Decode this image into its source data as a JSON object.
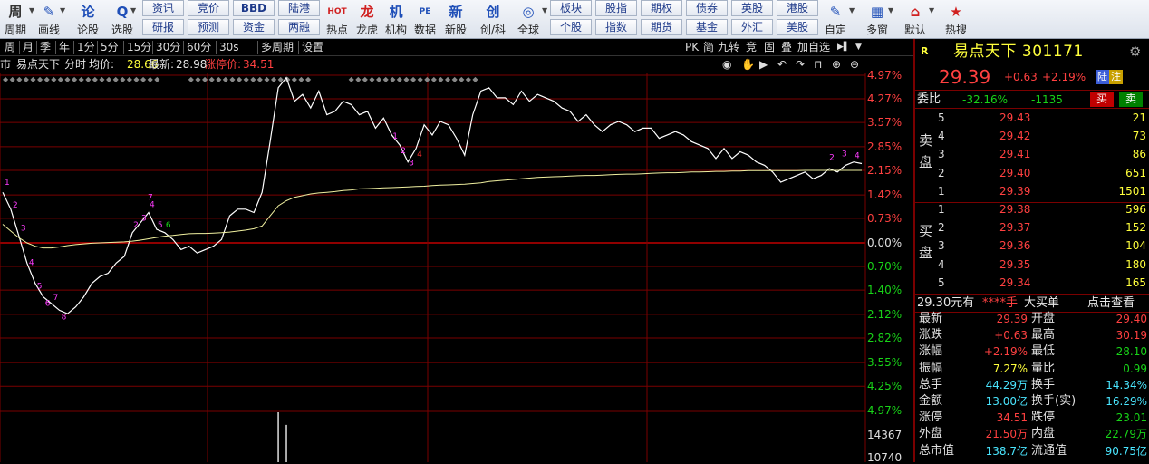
{
  "toolbar": {
    "big": [
      {
        "label": "周期",
        "icon": "周"
      },
      {
        "label": "画线",
        "icon": "✎"
      },
      {
        "label": "论股",
        "icon": "论"
      },
      {
        "label": "选股",
        "icon": "Q"
      },
      {
        "label": "热点",
        "icon": "HOT"
      },
      {
        "label": "龙虎",
        "icon": "龙"
      },
      {
        "label": "机构",
        "icon": "机"
      },
      {
        "label": "数据",
        "icon": "PE"
      },
      {
        "label": "新股",
        "icon": "新"
      },
      {
        "label": "创/科",
        "icon": "创"
      },
      {
        "label": "全球",
        "icon": "◎"
      },
      {
        "label": "自定",
        "icon": "✎"
      },
      {
        "label": "多窗",
        "icon": "▦"
      },
      {
        "label": "默认",
        "icon": "⌂"
      },
      {
        "label": "热搜",
        "icon": "★"
      }
    ],
    "small_top": [
      "资讯",
      "竞价",
      "BBD",
      "陆港",
      "板块",
      "股指",
      "期权",
      "债券",
      "英股",
      "港股"
    ],
    "small_bottom": [
      "研报",
      "预测",
      "资金",
      "两融",
      "个股",
      "指数",
      "期货",
      "基金",
      "外汇",
      "美股"
    ]
  },
  "period_bar": {
    "left_label": "",
    "items": [
      "周",
      "月",
      "季",
      "年",
      "1分",
      "5分",
      "15分",
      "30分",
      "60分",
      "30s",
      "多周期",
      "设置"
    ],
    "right_items": [
      "PK",
      "简",
      "九转",
      "竞",
      "固",
      "叠",
      "加自选"
    ]
  },
  "info_bar": {
    "market": "市",
    "stock_name": "易点天下",
    "mode": "分时",
    "avg_label": "均价:",
    "avg_value": "28.66",
    "latest_label": "最新:",
    "latest_value": "28.98",
    "limit_label": "涨停价:",
    "limit_value": "34.51"
  },
  "axis": {
    "right_labels": [
      "4.97%",
      "4.27%",
      "3.57%",
      "2.85%",
      "2.15%",
      "1.42%",
      "0.73%",
      "0.00%",
      "0.70%",
      "1.40%",
      "2.12%",
      "2.82%",
      "3.55%",
      "4.25%",
      "4.97%",
      "14367",
      "10740"
    ]
  },
  "chart_data": {
    "type": "line",
    "title": "",
    "xlabel": "",
    "ylabel": "",
    "ylim_pct": [
      -4.97,
      4.97
    ],
    "series": [
      {
        "name": "",
        "kind": "price_pct",
        "values": [
          1.5,
          1.0,
          0.2,
          -0.6,
          -1.2,
          -1.6,
          -1.8,
          -2.0,
          -2.1,
          -1.9,
          -1.6,
          -1.2,
          -1.0,
          -0.9,
          -0.6,
          -0.4,
          0.3,
          0.6,
          0.9,
          0.4,
          0.3,
          0.1,
          -0.2,
          -0.1,
          -0.3,
          -0.2,
          -0.1,
          0.1,
          0.8,
          1.0,
          1.0,
          0.9,
          1.5,
          3.0,
          4.6,
          4.9,
          4.2,
          4.4,
          4.0,
          4.5,
          3.8,
          3.9,
          4.2,
          4.1,
          3.8,
          3.9,
          3.4,
          3.7,
          3.2,
          2.9,
          2.4,
          2.8,
          3.5,
          3.2,
          3.6,
          3.5,
          3.1,
          2.6,
          3.8,
          4.5,
          4.6,
          4.3,
          4.3,
          4.1,
          4.5,
          4.2,
          4.4,
          4.3,
          4.2,
          4.0,
          3.9,
          3.6,
          3.8,
          3.5,
          3.3,
          3.5,
          3.6,
          3.5,
          3.3,
          3.4,
          3.4,
          3.1,
          3.2,
          3.3,
          3.2,
          3.0,
          2.9,
          2.8,
          2.5,
          2.8,
          2.5,
          2.7,
          2.6,
          2.4,
          2.3,
          2.1,
          1.8,
          1.9,
          2.0,
          2.1,
          1.9,
          2.0,
          2.2,
          2.1,
          2.3,
          2.4,
          2.35
        ]
      },
      {
        "name": "",
        "kind": "avg_pct",
        "values": [
          0.55,
          0.35,
          0.15,
          0.0,
          -0.1,
          -0.15,
          -0.15,
          -0.12,
          -0.08,
          -0.05,
          -0.03,
          -0.01,
          0.0,
          0.01,
          0.02,
          0.03,
          0.05,
          0.08,
          0.12,
          0.16,
          0.2,
          0.22,
          0.25,
          0.27,
          0.28,
          0.28,
          0.29,
          0.3,
          0.32,
          0.35,
          0.38,
          0.42,
          0.5,
          0.8,
          1.1,
          1.25,
          1.35,
          1.4,
          1.45,
          1.48,
          1.5,
          1.52,
          1.55,
          1.57,
          1.6,
          1.61,
          1.62,
          1.63,
          1.64,
          1.65,
          1.66,
          1.67,
          1.68,
          1.7,
          1.71,
          1.72,
          1.73,
          1.74,
          1.76,
          1.78,
          1.82,
          1.84,
          1.86,
          1.88,
          1.9,
          1.92,
          1.94,
          1.95,
          1.96,
          1.97,
          1.98,
          1.99,
          2.0,
          2.0,
          2.01,
          2.02,
          2.03,
          2.04,
          2.04,
          2.05,
          2.06,
          2.07,
          2.08,
          2.08,
          2.09,
          2.1,
          2.1,
          2.11,
          2.12,
          2.12,
          2.13,
          2.13,
          2.14,
          2.14,
          2.14,
          2.14,
          2.14,
          2.14,
          2.14,
          2.15,
          2.15,
          2.15,
          2.15,
          2.15,
          2.15,
          2.15,
          2.15
        ]
      }
    ],
    "volume_bars": [
      {
        "index": 34,
        "value": 14367
      },
      {
        "index": 35,
        "value": 10740
      }
    ],
    "signal_digits_pink": [
      "1",
      "2",
      "3",
      "4",
      "5",
      "6",
      "7",
      "8",
      "9"
    ],
    "grid": true
  },
  "quote_panel": {
    "r_badge": "R",
    "stock_title": "易点天下 301171",
    "price": "29.39",
    "change": "+0.63",
    "change_pct": "+2.19%",
    "badge_lu": "陆",
    "badge_zhu": "注",
    "weibi_label": "委比",
    "weibi_pct": "-32.16%",
    "weibi_diff": "-1135",
    "buy_btn": "买",
    "sell_btn": "卖",
    "sell_side_label": "卖\n盘",
    "buy_side_label": "买\n盘",
    "sell_orders": [
      {
        "level": "5",
        "price": "29.43",
        "vol": "21"
      },
      {
        "level": "4",
        "price": "29.42",
        "vol": "73"
      },
      {
        "level": "3",
        "price": "29.41",
        "vol": "86"
      },
      {
        "level": "2",
        "price": "29.40",
        "vol": "651"
      },
      {
        "level": "1",
        "price": "29.39",
        "vol": "1501"
      }
    ],
    "buy_orders": [
      {
        "level": "1",
        "price": "29.38",
        "vol": "596"
      },
      {
        "level": "2",
        "price": "29.37",
        "vol": "152"
      },
      {
        "level": "3",
        "price": "29.36",
        "vol": "104"
      },
      {
        "level": "4",
        "price": "29.35",
        "vol": "180"
      },
      {
        "level": "5",
        "price": "29.34",
        "vol": "165"
      }
    ],
    "big_order_price": "29.30元有",
    "big_order_vol": "****手",
    "big_order_label": "大买单",
    "big_order_link": "点击查看",
    "stats": [
      {
        "l1": "最新",
        "v1": "29.39",
        "c1": "red",
        "l2": "开盘",
        "v2": "29.40",
        "c2": "red"
      },
      {
        "l1": "涨跌",
        "v1": "+0.63",
        "c1": "red",
        "l2": "最高",
        "v2": "30.19",
        "c2": "red"
      },
      {
        "l1": "涨幅",
        "v1": "+2.19%",
        "c1": "red",
        "l2": "最低",
        "v2": "28.10",
        "c2": "grn"
      },
      {
        "l1": "振幅",
        "v1": "7.27%",
        "c1": "yel",
        "l2": "量比",
        "v2": "0.99",
        "c2": "grn"
      },
      {
        "l1": "总手",
        "v1": "44.29万",
        "c1": "cyan",
        "l2": "换手",
        "v2": "14.34%",
        "c2": "cyan"
      },
      {
        "l1": "金额",
        "v1": "13.00亿",
        "c1": "cyan",
        "l2": "换手(实)",
        "v2": "16.29%",
        "c2": "cyan"
      },
      {
        "l1": "涨停",
        "v1": "34.51",
        "c1": "red",
        "l2": "跌停",
        "v2": "23.01",
        "c2": "grn"
      },
      {
        "l1": "外盘",
        "v1": "21.50万",
        "c1": "red",
        "l2": "内盘",
        "v2": "22.79万",
        "c2": "grn"
      },
      {
        "l1": "总市值",
        "v1": "138.7亿",
        "c1": "cyan",
        "l2": "流通值",
        "v2": "90.75亿",
        "c2": "cyan"
      }
    ]
  },
  "colors": {
    "up": "#ff4040",
    "down": "#18d318",
    "grid": "#7a0000",
    "price_line": "#ffffff",
    "avg_line": "#f0f0a0",
    "accent": "#ffff3c"
  }
}
